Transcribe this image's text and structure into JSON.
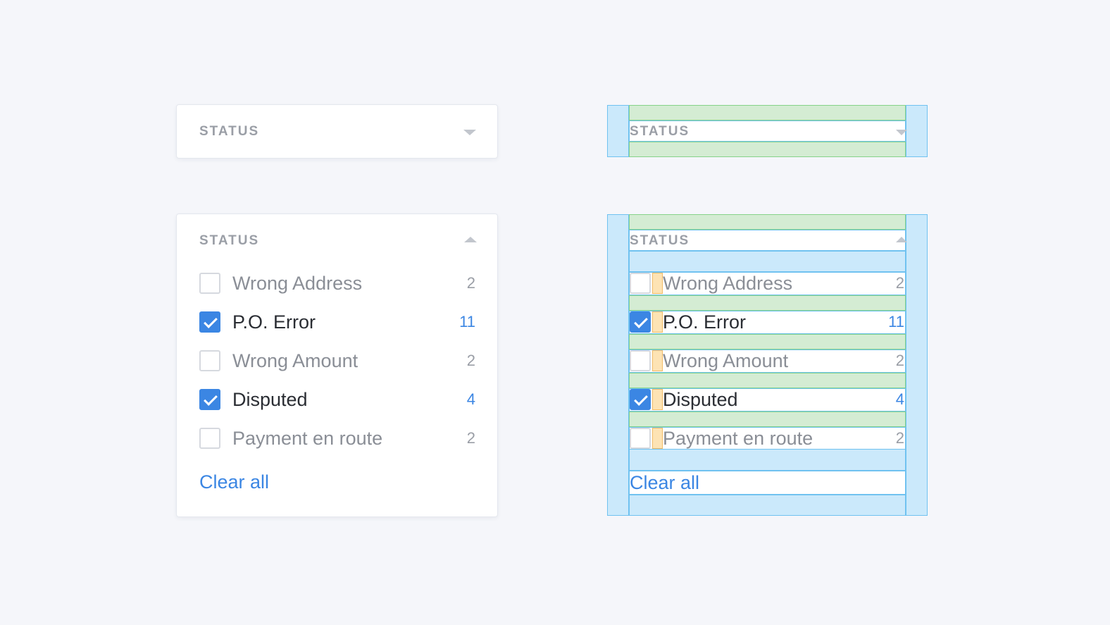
{
  "collapsed_panel": {
    "title": "STATUS",
    "toggle_icon": "chevron-down-icon"
  },
  "expanded_panel": {
    "title": "STATUS",
    "toggle_icon": "chevron-up-icon",
    "items": [
      {
        "label": "Wrong Address",
        "count": "2",
        "checked": false
      },
      {
        "label": "P.O. Error",
        "count": "11",
        "checked": true
      },
      {
        "label": "Wrong Amount",
        "count": "2",
        "checked": false
      },
      {
        "label": "Disputed",
        "count": "4",
        "checked": true
      },
      {
        "label": "Payment en route",
        "count": "2",
        "checked": false
      }
    ],
    "clear_label": "Clear all"
  },
  "colors": {
    "accent": "#3b86e3",
    "padding_overlay": "#cbe9fb",
    "gap_overlay": "#d4ecd3",
    "inner_gap_overlay": "#fde3b4"
  }
}
